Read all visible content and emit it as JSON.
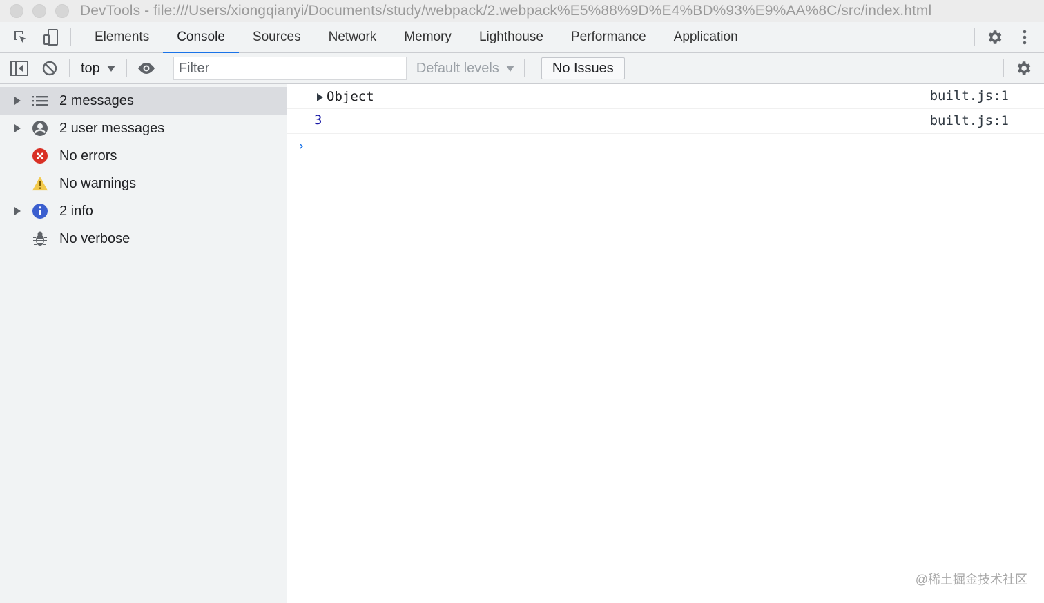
{
  "window": {
    "title": "DevTools - file:///Users/xiongqianyi/Documents/study/webpack/2.webpack%E5%88%9D%E4%BD%93%E9%AA%8C/src/index.html"
  },
  "tabs": [
    {
      "label": "Elements"
    },
    {
      "label": "Console"
    },
    {
      "label": "Sources"
    },
    {
      "label": "Network"
    },
    {
      "label": "Memory"
    },
    {
      "label": "Lighthouse"
    },
    {
      "label": "Performance"
    },
    {
      "label": "Application"
    }
  ],
  "toolbar": {
    "context": "top",
    "filter_placeholder": "Filter",
    "levels": "Default levels",
    "issues": "No Issues"
  },
  "sidebar": {
    "items": [
      {
        "label": "2 messages",
        "icon": "list-icon"
      },
      {
        "label": "2 user messages",
        "icon": "user-icon"
      },
      {
        "label": "No errors",
        "icon": "error-icon"
      },
      {
        "label": "No warnings",
        "icon": "warning-icon"
      },
      {
        "label": "2 info",
        "icon": "info-icon"
      },
      {
        "label": "No verbose",
        "icon": "bug-icon"
      }
    ]
  },
  "console": {
    "messages": [
      {
        "text": "Object",
        "source": "built.js:1"
      },
      {
        "text": "3",
        "source": "built.js:1"
      }
    ],
    "prompt": "›"
  },
  "colors": {
    "accent": "#1a73e8",
    "error": "#d93025",
    "warning": "#f2c94c",
    "info": "#3b5fcf"
  },
  "watermark": "@稀土掘金技术社区"
}
